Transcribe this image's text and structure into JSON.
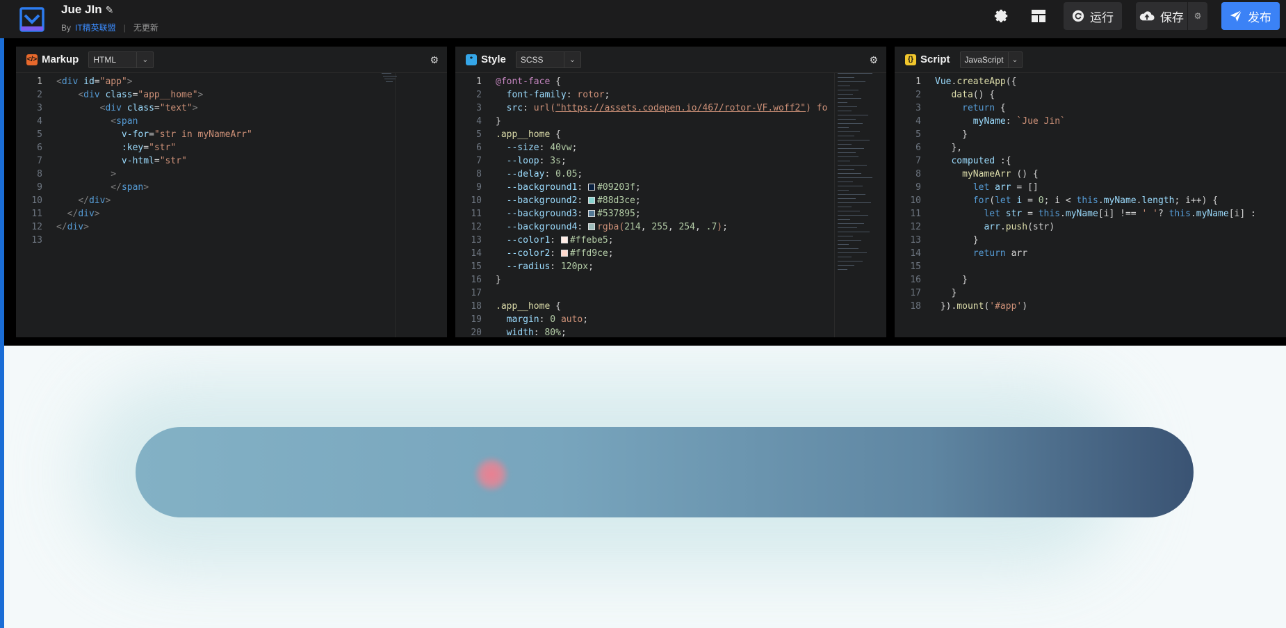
{
  "header": {
    "title": "Jue JIn",
    "author_prefix": "By",
    "author": "IT精英联盟",
    "status": "无更新",
    "run_label": "运行",
    "save_label": "保存",
    "publish_label": "发布"
  },
  "panels": {
    "markup": {
      "name": "Markup",
      "lang": "HTML",
      "icon": "</>"
    },
    "style": {
      "name": "Style",
      "lang": "SCSS",
      "icon": "*"
    },
    "script": {
      "name": "Script",
      "lang": "JavaScript",
      "icon": "{}"
    }
  },
  "colors": {
    "accent": "#1a6dd6",
    "publish": "#3b82f6",
    "markup_icon": "#e8692c",
    "style_icon": "#35a6e8",
    "script_icon": "#f2c72d"
  },
  "icons": {
    "settings": "gear-icon",
    "layout": "layout-grid-icon",
    "run": "refresh-icon",
    "save": "cloud-upload-icon",
    "publish": "send-icon"
  }
}
